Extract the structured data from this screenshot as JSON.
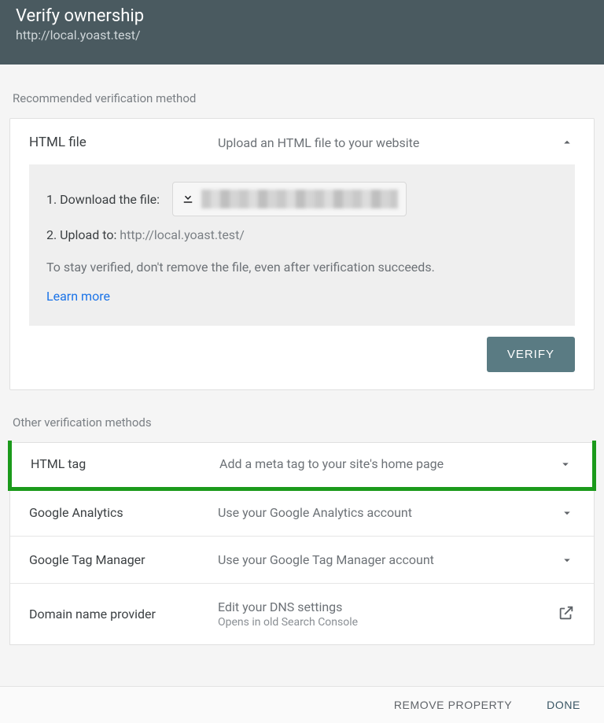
{
  "header": {
    "title": "Verify ownership",
    "url": "http://local.yoast.test/"
  },
  "sections": {
    "recommended_label": "Recommended verification method",
    "other_label": "Other verification methods"
  },
  "recommended": {
    "name": "HTML file",
    "desc": "Upload an HTML file to your website",
    "step1_label": "1. Download the file:",
    "step2_label": "2. Upload to:",
    "upload_target": "http://local.yoast.test/",
    "note": "To stay verified, don't remove the file, even after verification succeeds.",
    "learn_more": "Learn more",
    "verify_btn": "VERIFY"
  },
  "methods": {
    "html_tag": {
      "name": "HTML tag",
      "desc": "Add a meta tag to your site's home page"
    },
    "ga": {
      "name": "Google Analytics",
      "desc": "Use your Google Analytics account"
    },
    "gtm": {
      "name": "Google Tag Manager",
      "desc": "Use your Google Tag Manager account"
    },
    "dns": {
      "name": "Domain name provider",
      "desc": "Edit your DNS settings",
      "sub": "Opens in old Search Console"
    }
  },
  "footer": {
    "remove": "REMOVE PROPERTY",
    "done": "DONE"
  }
}
